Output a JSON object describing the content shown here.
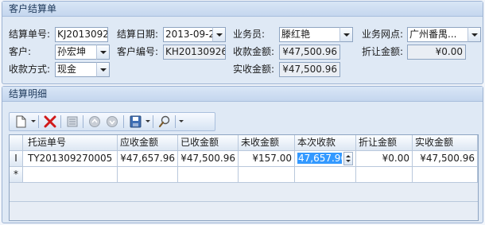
{
  "form": {
    "title": "客户结算单",
    "settle_no_label": "结算单号:",
    "settle_no_value": "KJ2013092",
    "settle_date_label": "结算日期:",
    "settle_date_value": "2013-09-2",
    "salesman_label": "业务员:",
    "salesman_value": "滕红艳",
    "branch_label": "业务网点:",
    "branch_value": "广州番禺...",
    "customer_label": "客户:",
    "customer_value": "孙宏坤",
    "customer_no_label": "客户编号:",
    "customer_no_value": "KH201309260",
    "receivable_label": "收款金额:",
    "receivable_value": "¥47,500.96",
    "discount_label": "折让金额:",
    "discount_value": "¥0.00",
    "payment_label": "收款方式:",
    "payment_value": "现金",
    "actual_label": "实收金额:",
    "actual_value": "¥47,500.96"
  },
  "detail": {
    "title": "结算明细",
    "toolbar": {
      "new_icon": "new-document-icon",
      "delete_icon": "delete-x-icon",
      "clear_icon": "clear-icon",
      "up_icon": "move-up-icon",
      "down_icon": "move-down-icon",
      "save_icon": "save-icon",
      "search_icon": "search-icon"
    },
    "columns": [
      "托运单号",
      "应收金额",
      "已收金额",
      "未收金额",
      "本次收款",
      "折让金额",
      "实收金额"
    ],
    "rows": [
      {
        "indicator": "I",
        "cells": [
          "TY201309270005",
          "¥47,657.96",
          "¥47,500.96",
          "¥157.00",
          "47,657.96",
          "¥0.00",
          "¥47,500.96"
        ]
      }
    ],
    "new_row_indicator": "*"
  },
  "colors": {
    "panel_bg": "#dfe9f5",
    "panel_title_text": "#1e395b",
    "selection": "#3399ff"
  }
}
